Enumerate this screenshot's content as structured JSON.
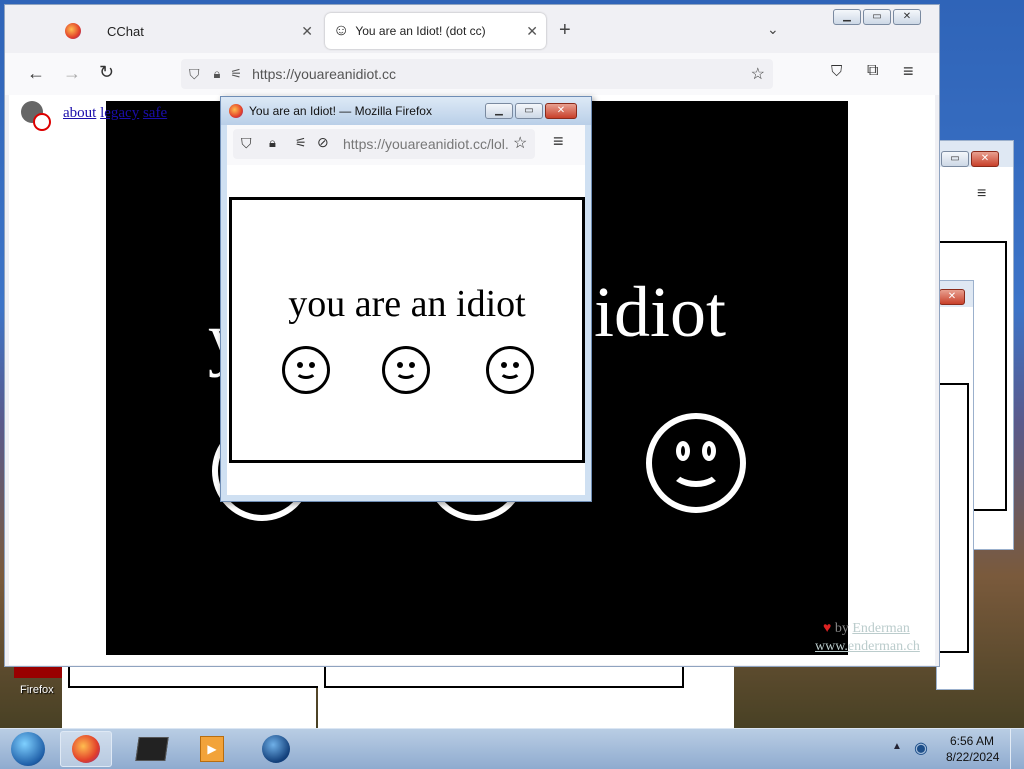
{
  "desktop": {
    "firefox_label": "Firefox"
  },
  "main_window": {
    "tabs": [
      {
        "title": "CChat"
      },
      {
        "title": "You are an Idiot! (dot cc)"
      }
    ],
    "url": "https://youareanidiot.cc",
    "page_links": [
      "about",
      "legacy",
      "safe"
    ],
    "big_text": "idiot",
    "credit_prefix": "by",
    "credit_name": "Enderman",
    "credit_url": "www.enderman.ch"
  },
  "popup": {
    "title": "You are an Idiot! — Mozilla Firefox",
    "url": "https://youareanidiot.cc/lol.",
    "message": "you are an idiot"
  },
  "taskbar": {
    "time": "6:56 AM",
    "date": "8/22/2024"
  },
  "colors": {
    "taskbar": "#9fb8d8",
    "link": "#1a0dab",
    "close_button": "#c8402a"
  }
}
